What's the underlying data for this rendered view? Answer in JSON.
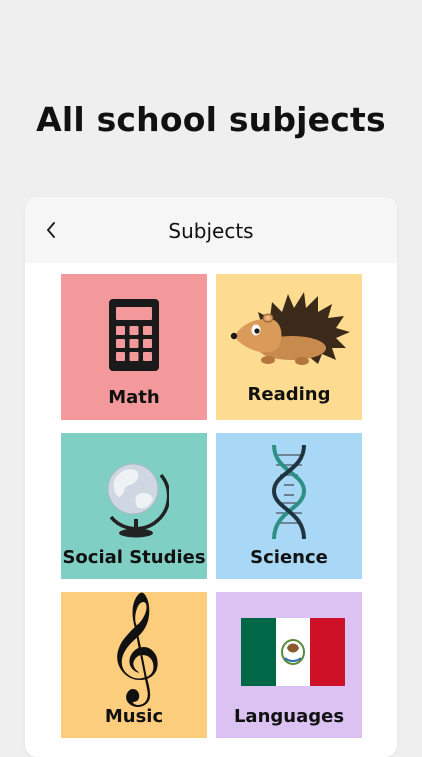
{
  "promo": {
    "headline": "All school subjects"
  },
  "nav": {
    "title": "Subjects",
    "back_icon": "chevron-left-icon"
  },
  "subjects": [
    {
      "label": "Math",
      "color": "#f4999b",
      "icon": "calculator-icon"
    },
    {
      "label": "Reading",
      "color": "#fddc92",
      "icon": "hedgehog-icon"
    },
    {
      "label": "Social Studies",
      "color": "#7fcfc4",
      "icon": "globe-icon"
    },
    {
      "label": "Science",
      "color": "#a8d8f5",
      "icon": "dna-icon"
    },
    {
      "label": "Music",
      "color": "#fdcd7e",
      "icon": "treble-clef-icon"
    },
    {
      "label": "Languages",
      "color": "#dcc2f3",
      "icon": "mexico-flag-icon"
    }
  ]
}
